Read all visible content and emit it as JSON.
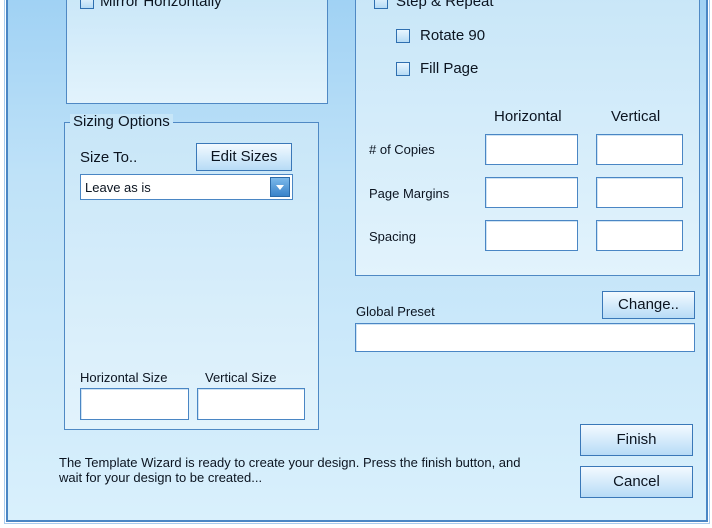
{
  "mirror": {
    "label": "Mirror Horizontally",
    "checked": false
  },
  "layout": {
    "step_repeat": {
      "label": "Step & Repeat",
      "checked": false
    },
    "rotate": {
      "label": "Rotate 90",
      "checked": false
    },
    "fill_page": {
      "label": "Fill Page",
      "checked": false
    },
    "col_horizontal": "Horizontal",
    "col_vertical": "Vertical",
    "rows": [
      {
        "label": "# of Copies",
        "horizontal": "",
        "vertical": ""
      },
      {
        "label": "Page Margins",
        "horizontal": "",
        "vertical": ""
      },
      {
        "label": "Spacing",
        "horizontal": "",
        "vertical": ""
      }
    ]
  },
  "sizing": {
    "title": "Sizing Options",
    "size_to_label": "Size To..",
    "edit_sizes_label": "Edit Sizes",
    "size_select_value": "Leave as is",
    "horizontal_size_label": "Horizontal Size",
    "vertical_size_label": "Vertical Size",
    "horizontal_size_value": "",
    "vertical_size_value": ""
  },
  "preset": {
    "label": "Global Preset",
    "change_label": "Change..",
    "value": ""
  },
  "footer": {
    "message": "The Template Wizard is ready to create your design. Press the finish button, and wait for your design to be created...",
    "finish_label": "Finish",
    "cancel_label": "Cancel"
  },
  "colors": {
    "window_border": "#4a86c4",
    "background_top": "#9fd1f4",
    "background_bottom": "#d9f0fc",
    "dropdown_arrow": "#3a83c9"
  }
}
